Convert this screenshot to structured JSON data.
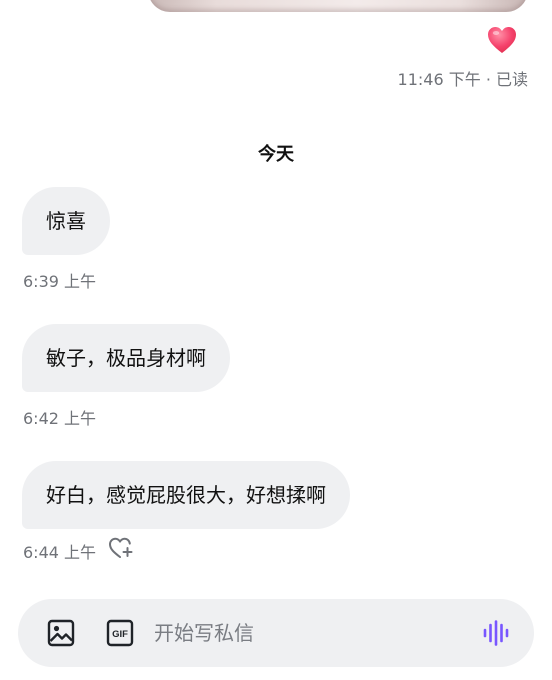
{
  "sent_message": {
    "reaction": "heart-emoji",
    "meta": "11:46 下午 · 已读"
  },
  "day_divider": "今天",
  "messages": [
    {
      "text": "惊喜",
      "time": "6:39 上午"
    },
    {
      "text": "敏子，极品身材啊",
      "time": "6:42 上午"
    },
    {
      "text": "好白，感觉屁股很大，好想揉啊",
      "time": "6:44 上午"
    }
  ],
  "composer": {
    "placeholder": "开始写私信",
    "icons": [
      "image-icon",
      "gif-icon",
      "voice-icon"
    ]
  },
  "colors": {
    "bubble_bg": "#eff0f2",
    "text": "#111111",
    "meta_text": "#6f7278",
    "accent": "#7856ff",
    "heart": "#f5426c"
  }
}
